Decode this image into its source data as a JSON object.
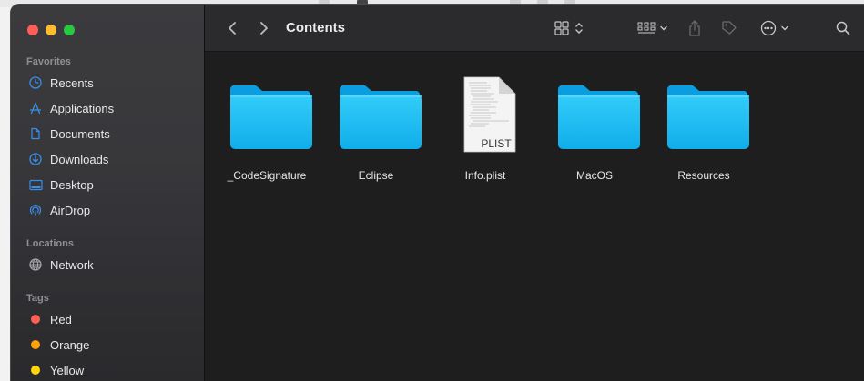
{
  "window": {
    "title": "Contents"
  },
  "sidebar": {
    "sections": {
      "favorites": "Favorites",
      "locations": "Locations",
      "tags": "Tags"
    },
    "favorites": [
      {
        "label": "Recents",
        "icon": "clock-icon"
      },
      {
        "label": "Applications",
        "icon": "applications-icon"
      },
      {
        "label": "Documents",
        "icon": "document-icon"
      },
      {
        "label": "Downloads",
        "icon": "download-icon"
      },
      {
        "label": "Desktop",
        "icon": "desktop-icon"
      },
      {
        "label": "AirDrop",
        "icon": "airdrop-icon"
      }
    ],
    "locations": [
      {
        "label": "Network",
        "icon": "network-icon"
      }
    ],
    "tags": [
      {
        "label": "Red",
        "color": "#ff5f57"
      },
      {
        "label": "Orange",
        "color": "#ff9f0a"
      },
      {
        "label": "Yellow",
        "color": "#ffd60a"
      }
    ]
  },
  "files": [
    {
      "name": "_CodeSignature",
      "type": "folder"
    },
    {
      "name": "Eclipse",
      "type": "folder"
    },
    {
      "name": "Info.plist",
      "type": "document",
      "badge": "PLIST"
    },
    {
      "name": "MacOS",
      "type": "folder"
    },
    {
      "name": "Resources",
      "type": "folder"
    }
  ],
  "colors": {
    "accent": "#3a8ee6",
    "folder": "#1fb7f2"
  }
}
